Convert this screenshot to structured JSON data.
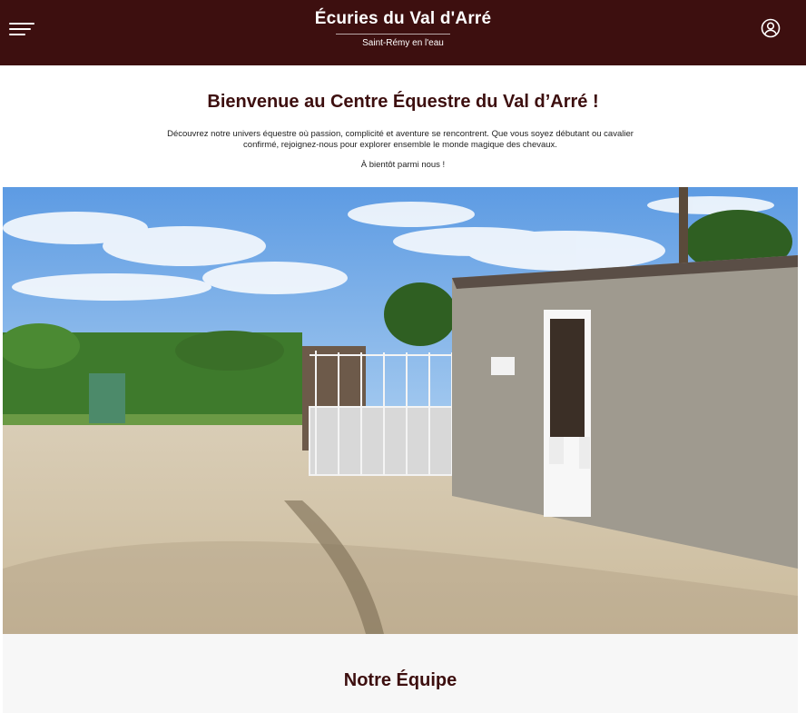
{
  "header": {
    "title": "Écuries du Val d'Arré",
    "subtitle": "Saint-Rémy en l'eau",
    "menu_icon": "hamburger-menu-icon",
    "account_icon": "user-circle-icon",
    "background_color": "#3d0f0f"
  },
  "welcome": {
    "title": "Bienvenue au Centre Équestre du Val d’Arré !",
    "text": "Découvrez notre univers équestre où passion, complicité et aventure se rencontrent. Que vous soyez débutant ou cavalier confirmé, rejoignez-nous pour explorer ensemble le monde magique des chevaux.",
    "signoff": "À bientôt parmi nous !"
  },
  "team": {
    "title": "Notre Équipe"
  },
  "colors": {
    "accent": "#3d0f0f",
    "section_background": "#f7f7f7"
  }
}
